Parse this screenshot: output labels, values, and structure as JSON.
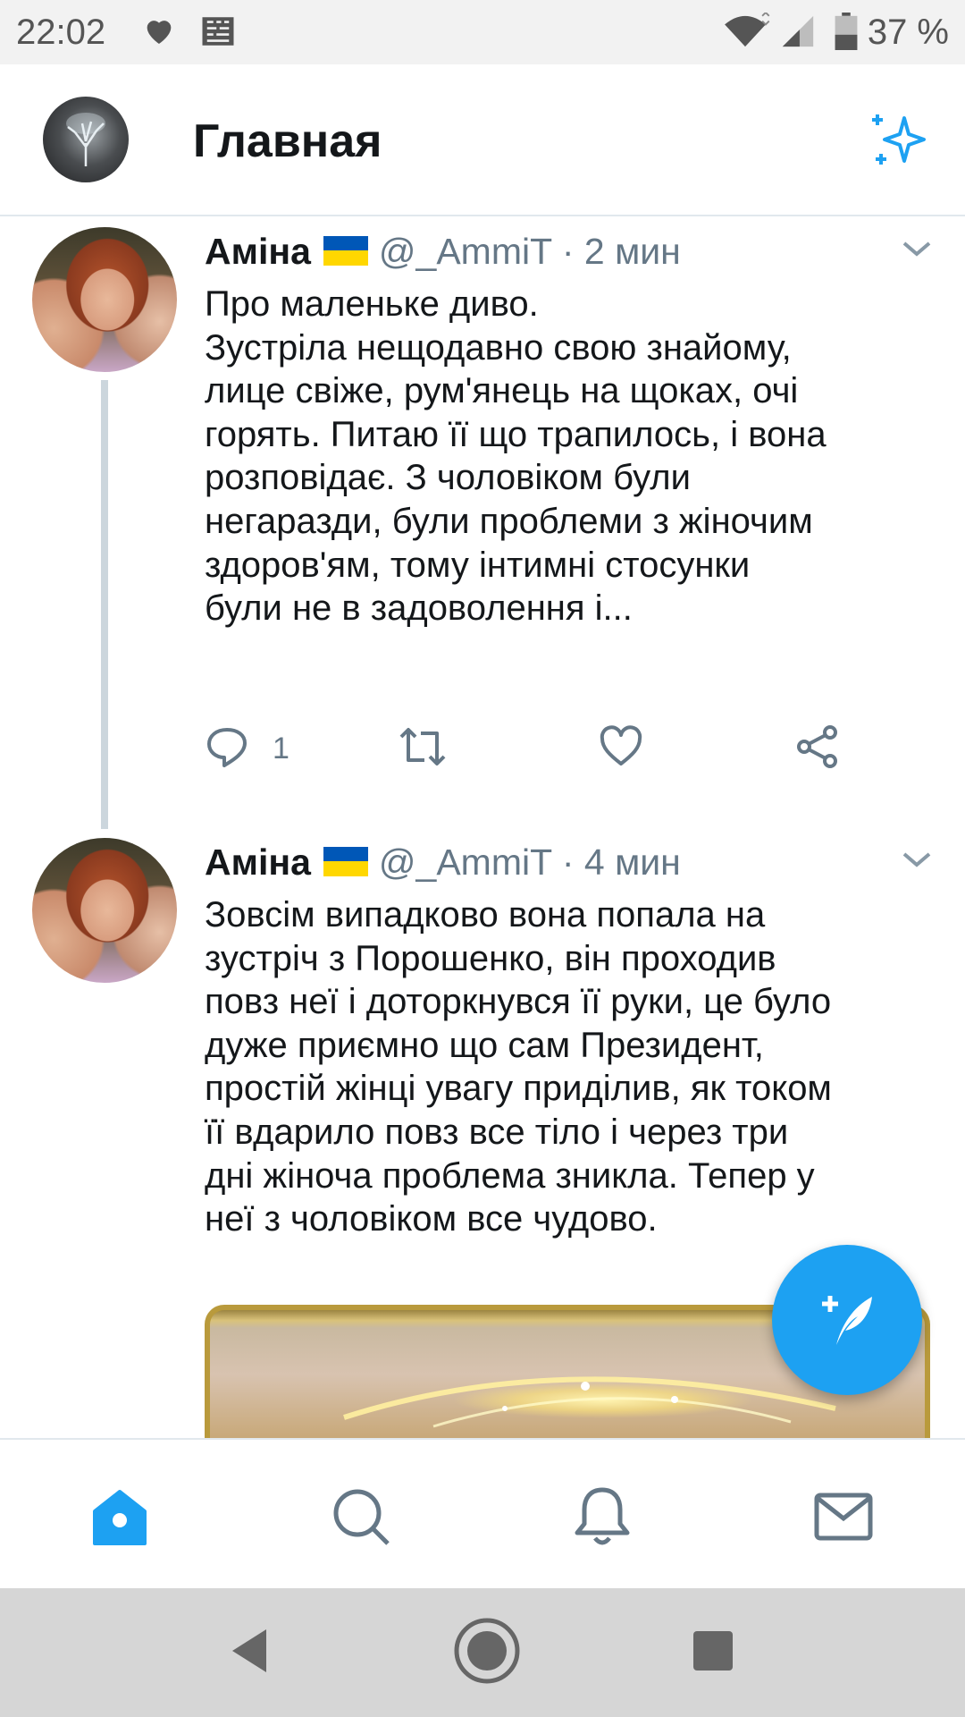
{
  "status_bar": {
    "time": "22:02",
    "battery_percent": "37 %",
    "icons": [
      "heart-icon",
      "image-icon",
      "wifi-icon",
      "signal-icon",
      "battery-icon"
    ]
  },
  "header": {
    "title": "Главная",
    "icons": [
      "profile-avatar",
      "sparkle-icon"
    ]
  },
  "tweets": [
    {
      "name": "Аміна",
      "handle": "@_AmmiT",
      "separator": "·",
      "time": "2 мин",
      "text": "Про маленьке диво.\nЗустріла нещодавно свою знайому,\nлице свіже, рум'янець на щоках, очі\nгорять. Питаю її що трапилось, і вона\nрозповідає. З чоловіком були\nнегаразди, були проблеми з жіночим\nздоров'ям, тому інтимні стосунки\nбули не в задоволення і...",
      "reply_count": "1"
    },
    {
      "name": "Аміна",
      "handle": "@_AmmiT",
      "separator": "·",
      "time": "4 мин",
      "text": "Зовсім випадково вона попала на\nзустріч з Порошенко, він проходив\nповз неї і доторкнувся її руки, це було\nдуже приємно що сам Президент,\nпростій жінці увагу приділив, як током\nїї вдарило повз все тіло і через три\nдні жіноча проблема зникла. Тепер у\nнеї з чоловіком все чудово."
    }
  ],
  "colors": {
    "accent": "#1da1f2",
    "text_primary": "#14171a",
    "text_secondary": "#657786",
    "divider": "#e1e8ed"
  },
  "tab_bar": {
    "tabs": [
      "home-icon",
      "search-icon",
      "notifications-icon",
      "messages-icon"
    ],
    "active": "home-icon"
  },
  "android_nav": [
    "back-icon",
    "home-circle-icon",
    "recents-icon"
  ]
}
